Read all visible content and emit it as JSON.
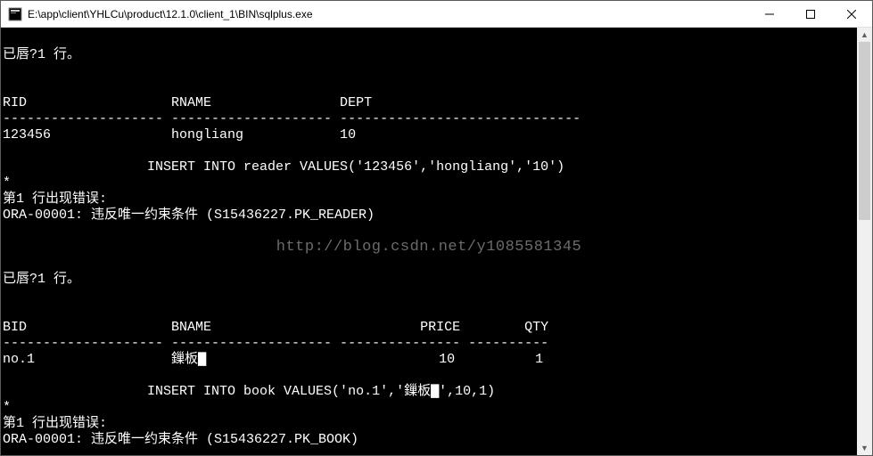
{
  "window": {
    "title": "E:\\app\\client\\YHLCu\\product\\12.1.0\\client_1\\BIN\\sqlplus.exe"
  },
  "console": {
    "lines": [
      "",
      "已唇?1 行。",
      "",
      "",
      "RID                  RNAME                DEPT",
      "-------------------- -------------------- ------------------------------",
      "123456               hongliang            10",
      "",
      "                  INSERT INTO reader VALUES('123456','hongliang','10')",
      "*",
      "第1 行出现错误:",
      "ORA-00001: 违反唯一约束条件 (S15436227.PK_READER)",
      "",
      "",
      "",
      "已唇?1 行。",
      "",
      "",
      "BID                  BNAME                          PRICE        QTY",
      "-------------------- -------------------- --------------- ----------",
      "no.1                 鏁板▇                             10          1",
      "",
      "                  INSERT INTO book VALUES('no.1','鏁板▇',10,1)",
      "*",
      "第1 行出现错误:",
      "ORA-00001: 违反唯一约束条件 (S15436227.PK_BOOK)",
      ""
    ]
  },
  "watermark": "http://blog.csdn.net/y1085581345"
}
